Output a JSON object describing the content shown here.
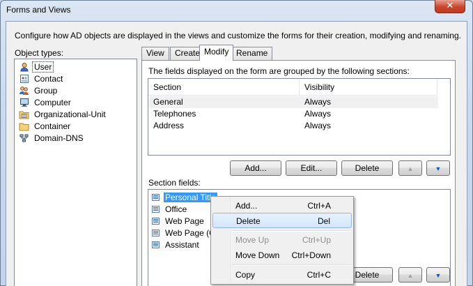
{
  "window": {
    "title": "Forms and Views",
    "close_glyph": "✕"
  },
  "description": "Configure how AD objects are displayed in the views and customize the forms for their creation, modifying and renaming.",
  "object_types": {
    "label": "Object types:",
    "items": [
      {
        "label": "User",
        "icon": "user-icon"
      },
      {
        "label": "Contact",
        "icon": "contact-icon"
      },
      {
        "label": "Group",
        "icon": "group-icon"
      },
      {
        "label": "Computer",
        "icon": "computer-icon"
      },
      {
        "label": "Organizational-Unit",
        "icon": "organizational-unit-icon"
      },
      {
        "label": "Container",
        "icon": "container-icon"
      },
      {
        "label": "Domain-DNS",
        "icon": "domain-dns-icon"
      }
    ],
    "selected": "User"
  },
  "tabs": [
    {
      "label": "View"
    },
    {
      "label": "Create"
    },
    {
      "label": "Modify"
    },
    {
      "label": "Rename"
    }
  ],
  "active_tab": "Modify",
  "sections": {
    "label": "The fields displayed on the form are grouped by the following sections:",
    "columns": [
      "Section",
      "Visibility"
    ],
    "rows": [
      {
        "section": "General",
        "visibility": "Always"
      },
      {
        "section": "Telephones",
        "visibility": "Always"
      },
      {
        "section": "Address",
        "visibility": "Always"
      }
    ],
    "buttons": {
      "add": "Add...",
      "edit": "Edit...",
      "delete": "Delete",
      "up_glyph": "▲",
      "down_glyph": "▼"
    }
  },
  "section_fields": {
    "label": "Section fields:",
    "items": [
      {
        "label": "Personal Title"
      },
      {
        "label": "Office"
      },
      {
        "label": "Web Page"
      },
      {
        "label": "Web Page (Ot"
      },
      {
        "label": "Assistant"
      }
    ],
    "selected": "Personal Title",
    "buttons": {
      "delete": "Delete",
      "up_glyph": "▲",
      "down_glyph": "▼"
    }
  },
  "context_menu": {
    "items": [
      {
        "label": "Add...",
        "shortcut": "Ctrl+A",
        "enabled": true
      },
      {
        "label": "Delete",
        "shortcut": "Del",
        "enabled": true,
        "highlighted": true
      },
      {
        "label": "Move Up",
        "shortcut": "Ctrl+Up",
        "enabled": false
      },
      {
        "label": "Move Down",
        "shortcut": "Ctrl+Down",
        "enabled": true
      },
      {
        "label": "Copy",
        "shortcut": "Ctrl+C",
        "enabled": true
      }
    ]
  },
  "colors": {
    "selection": "#3399ff",
    "menu_highlight": "#d4e6fb",
    "close_button": "#c9462c",
    "arrow_enabled": "#1b55c9",
    "arrow_disabled": "#9aa0a8"
  }
}
